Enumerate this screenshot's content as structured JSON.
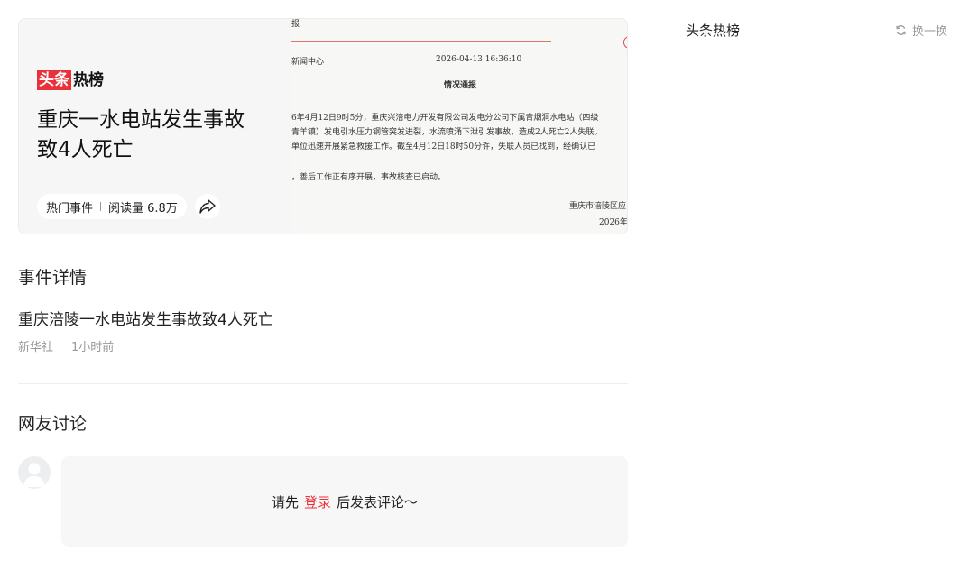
{
  "hero": {
    "logo_red": "头条",
    "logo_black": "热榜",
    "title": "重庆一水电站发生事故致4人死亡",
    "category": "热门事件",
    "reads": "阅读量 6.8万",
    "share_icon": "share-icon",
    "doc": {
      "top_fragment": "报",
      "from": "新闻中心",
      "date": "2026-04-13 16:36:10",
      "heading": "情况通报",
      "lines": [
        "6年4月12日9时5分，重庆兴涪电力开发有限公司发电分公司下属青烟洞水电站（四级",
        "青羊镇）发电引水压力钢管突发进裂，水流喷涌下泄引发事故，造成2人死亡2人失联。",
        "单位迅速开展紧急救援工作。截至4月12日18时50分许，失联人员已找到，经确认已",
        "，善后工作正有序开展，事故核查已启动。"
      ],
      "sign": "重庆市涪陵区应",
      "sign_date": "2026年"
    }
  },
  "detail": {
    "section_title": "事件详情",
    "article_title": "重庆涪陵一水电站发生事故致4人死亡",
    "source": "新华社",
    "time": "1小时前"
  },
  "comments": {
    "section_title": "网友讨论",
    "prompt_before": "请先",
    "login_link": "登录",
    "prompt_after": "后发表评论～"
  },
  "rail": {
    "title": "头条热榜",
    "refresh_label": "换一换"
  },
  "colors": {
    "brand_red": "#e8313a",
    "muted": "#999999"
  }
}
